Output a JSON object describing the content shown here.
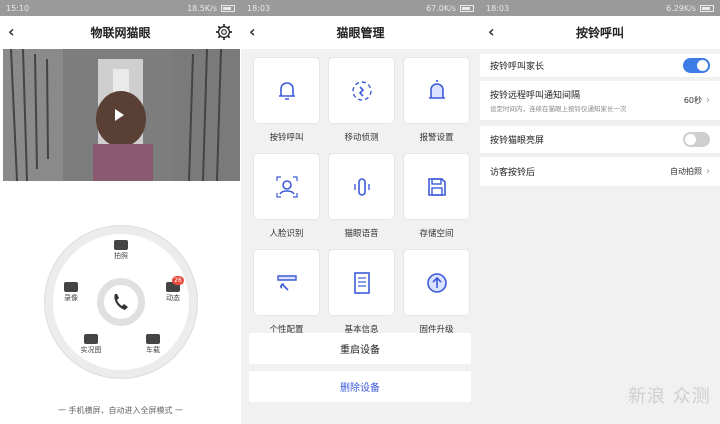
{
  "panel1": {
    "status": {
      "time": "15:10",
      "right": "18.5K/s"
    },
    "title": "物联网猫眼",
    "wheel": {
      "top": "拍照",
      "left": "录像",
      "right": "动态",
      "bottom_left": "实况图",
      "bottom_right": "车载"
    },
    "badge": "26",
    "hint": "一 手机横屏，自动进入全屏模式 一"
  },
  "panel2": {
    "status": {
      "time": "18:03",
      "right": "67.0K/s"
    },
    "title": "猫眼管理",
    "grid": [
      {
        "label": "按铃呼叫",
        "icon": "bell-icon"
      },
      {
        "label": "移动侦测",
        "icon": "motion-icon"
      },
      {
        "label": "报警设置",
        "icon": "alarm-icon"
      },
      {
        "label": "人脸识别",
        "icon": "face-icon"
      },
      {
        "label": "猫眼语音",
        "icon": "voice-icon"
      },
      {
        "label": "存储空间",
        "icon": "storage-icon"
      },
      {
        "label": "个性配置",
        "icon": "config-icon"
      },
      {
        "label": "基本信息",
        "icon": "info-icon"
      },
      {
        "label": "固件升级",
        "icon": "upgrade-icon"
      }
    ],
    "restart": "重启设备",
    "delete": "删除设备",
    "accent": "#3d5bd9"
  },
  "panel3": {
    "status": {
      "time": "18:03",
      "right": "6.29K/s"
    },
    "title": "按铃呼叫",
    "rows": {
      "notify_parent": {
        "label": "按铃呼叫家长",
        "on": true
      },
      "interval": {
        "label": "按铃远程呼叫通知间隔",
        "sub": "设定时间内，连续在猫眼上按铃仅通知家长一次",
        "value": "60秒"
      },
      "screen_on": {
        "label": "按铃猫眼亮屏",
        "on": false
      },
      "after_ring": {
        "label": "访客按铃后",
        "value": "自动拍照"
      }
    },
    "toggle_on_color": "#3c7ce6",
    "toggle_off_color": "#cfcfcf"
  },
  "watermark": "新浪 众测"
}
